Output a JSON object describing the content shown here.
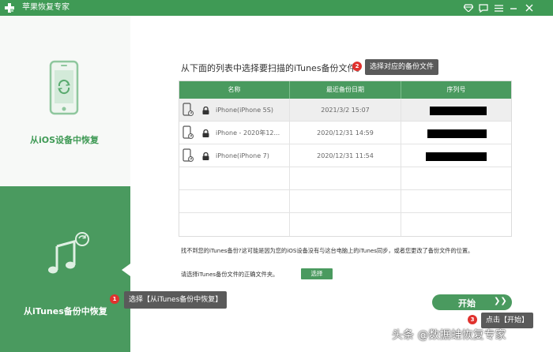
{
  "window": {
    "title": "苹果恢复专家"
  },
  "sidebar": {
    "top_label": "从iOS设备中恢复",
    "bottom_label": "从iTunes备份中恢复"
  },
  "main": {
    "instruction": "从下面的列表中选择要扫描的iTunes备份文件。",
    "table": {
      "headers": [
        "名称",
        "最近备份日期",
        "序列号"
      ],
      "rows": [
        {
          "name": "iPhone(iPhone 5S)",
          "date": "2021/3/2 15:07"
        },
        {
          "name": "iPhone - 2020年12...",
          "date": "2020/12/31 14:59"
        },
        {
          "name": "iPhone(iPhone 7)",
          "date": "2020/12/31 11:54"
        }
      ]
    },
    "note": "找不到您的iTunes备份?这可能是因为您的iOS设备没有与这台电脑上的iTunes同步，或者您更改了备份文件的位置。",
    "choose_label": "请选择iTunes备份文件的正确文件夹。",
    "choose_button": "选择",
    "start_button": "开始",
    "start_arrow": "❯❯"
  },
  "annotations": [
    {
      "num": "1",
      "text": "选择【从iTunes备份中恢复】"
    },
    {
      "num": "2",
      "text": "选择对应的备份文件"
    },
    {
      "num": "3",
      "text": "点击【开始】"
    }
  ],
  "watermark": "头条 @数据蛙恢复专家",
  "colors": {
    "brand_green": "#3f9a55",
    "accent_red": "#e0322e"
  }
}
